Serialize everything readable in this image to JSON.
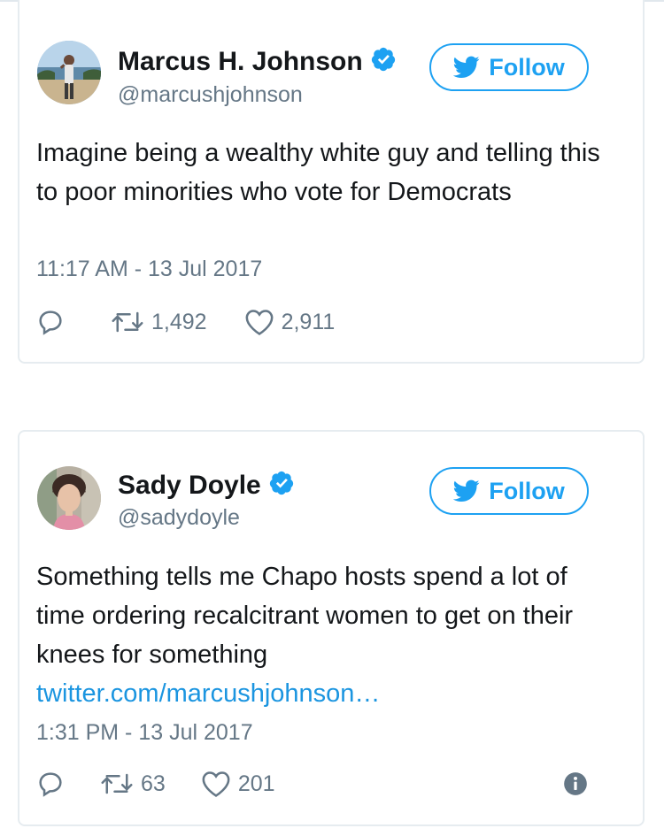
{
  "tweets": [
    {
      "author_name": "Marcus H. Johnson",
      "handle": "@marcushjohnson",
      "verified": true,
      "follow_label": "Follow",
      "text": "Imagine being a wealthy white guy and telling this to poor minorities who vote for Democrats",
      "link": "",
      "timestamp": "11:17 AM - 13 Jul 2017",
      "retweets": "1,492",
      "likes": "2,911"
    },
    {
      "author_name": "Sady Doyle",
      "handle": "@sadydoyle",
      "verified": true,
      "follow_label": "Follow",
      "text": "Something tells me Chapo hosts spend a lot of time ordering recalcitrant women to get on their knees for something",
      "link": "twitter.com/marcushjohnson…",
      "timestamp": "1:31 PM - 13 Jul 2017",
      "retweets": "63",
      "likes": "201"
    }
  ],
  "colors": {
    "accent": "#1da1f2",
    "link": "#1b95e0",
    "secondary_text": "#657786",
    "card_border": "#e6ecf0"
  },
  "icons": [
    "verified-badge-icon",
    "twitter-bird-icon",
    "reply-icon",
    "retweet-icon",
    "like-icon",
    "info-icon"
  ]
}
